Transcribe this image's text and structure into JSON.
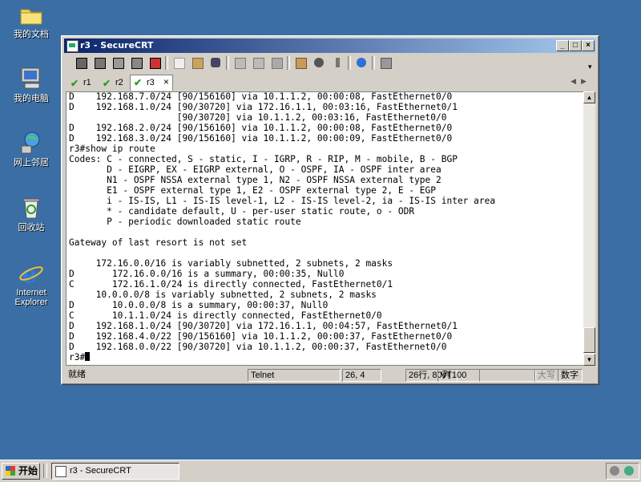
{
  "desktop": {
    "icons": [
      {
        "label": "我的文档"
      },
      {
        "label": "我的电脑"
      },
      {
        "label": "网上邻居"
      },
      {
        "label": "回收站"
      },
      {
        "label": "Internet Explorer"
      }
    ]
  },
  "window": {
    "title": "r3 - SecureCRT",
    "buttons": {
      "minimize": "_",
      "maximize": "□",
      "close": "×"
    }
  },
  "tabs": [
    {
      "label": "r1"
    },
    {
      "label": "r2"
    },
    {
      "label": "r3",
      "close": "×"
    }
  ],
  "terminal": {
    "lines": [
      "D    192.168.7.0/24 [90/156160] via 10.1.1.2, 00:00:08, FastEthernet0/0",
      "D    192.168.1.0/24 [90/30720] via 172.16.1.1, 00:03:16, FastEthernet0/1",
      "                    [90/30720] via 10.1.1.2, 00:03:16, FastEthernet0/0",
      "D    192.168.2.0/24 [90/156160] via 10.1.1.2, 00:00:08, FastEthernet0/0",
      "D    192.168.3.0/24 [90/156160] via 10.1.1.2, 00:00:09, FastEthernet0/0",
      "r3#show ip route",
      "Codes: C - connected, S - static, I - IGRP, R - RIP, M - mobile, B - BGP",
      "       D - EIGRP, EX - EIGRP external, O - OSPF, IA - OSPF inter area",
      "       N1 - OSPF NSSA external type 1, N2 - OSPF NSSA external type 2",
      "       E1 - OSPF external type 1, E2 - OSPF external type 2, E - EGP",
      "       i - IS-IS, L1 - IS-IS level-1, L2 - IS-IS level-2, ia - IS-IS inter area",
      "       * - candidate default, U - per-user static route, o - ODR",
      "       P - periodic downloaded static route",
      "",
      "Gateway of last resort is not set",
      "",
      "     172.16.0.0/16 is variably subnetted, 2 subnets, 2 masks",
      "D       172.16.0.0/16 is a summary, 00:00:35, Null0",
      "C       172.16.1.0/24 is directly connected, FastEthernet0/1",
      "     10.0.0.0/8 is variably subnetted, 2 subnets, 2 masks",
      "D       10.0.0.0/8 is a summary, 00:00:37, Null0",
      "C       10.1.1.0/24 is directly connected, FastEthernet0/0",
      "D    192.168.1.0/24 [90/30720] via 172.16.1.1, 00:04:57, FastEthernet0/1",
      "D    192.168.4.0/22 [90/156160] via 10.1.1.2, 00:00:37, FastEthernet0/0",
      "D    192.168.0.0/22 [90/30720] via 10.1.1.2, 00:00:37, FastEthernet0/0"
    ],
    "prompt": "r3#"
  },
  "statusbar": {
    "ready": "就绪",
    "protocol": "Telnet",
    "cursor_pos": "26, 4",
    "size": "26行, 80列",
    "emulation": "VT100",
    "caps": "大写",
    "num": "数字"
  },
  "taskbar": {
    "start": "开始",
    "task": "r3 - SecureCRT"
  }
}
